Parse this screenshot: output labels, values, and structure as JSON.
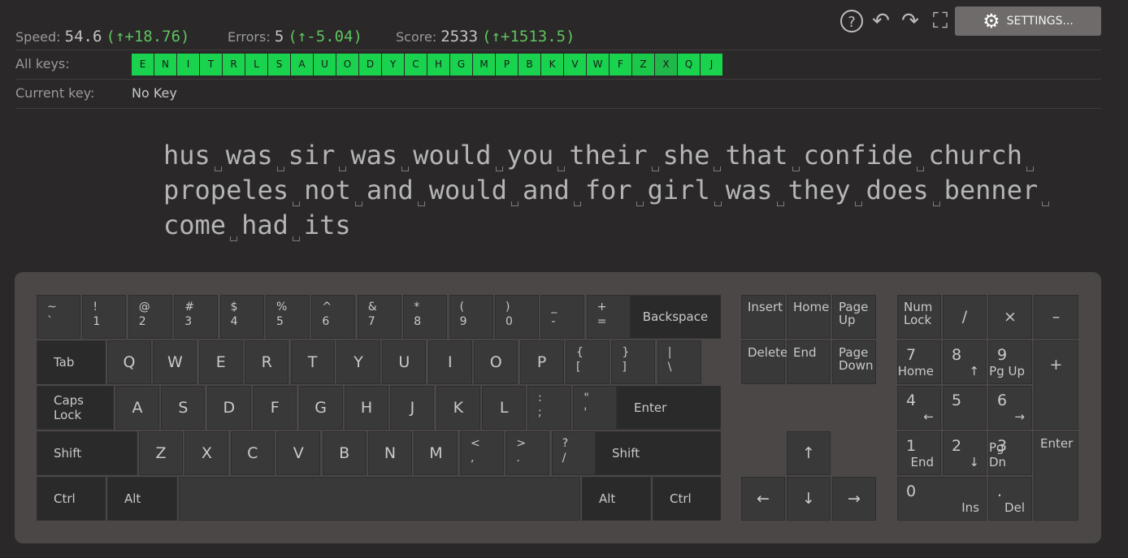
{
  "stats": {
    "speed_label": "Speed:",
    "speed_value": "54.6",
    "speed_delta": "(↑+18.76)",
    "errors_label": "Errors:",
    "errors_value": "5",
    "errors_delta": "(↑-5.04)",
    "score_label": "Score:",
    "score_value": "2533",
    "score_delta": "(↑+1513.5)"
  },
  "toolbar": {
    "help_icon": "?",
    "undo_icon": "↶",
    "redo_icon": "↷",
    "fullscreen_icon": "⛶",
    "settings_label": "SETTINGS..."
  },
  "all_keys": {
    "label": "All keys:",
    "keys": [
      "E",
      "N",
      "I",
      "T",
      "R",
      "L",
      "S",
      "A",
      "U",
      "O",
      "D",
      "Y",
      "C",
      "H",
      "G",
      "M",
      "P",
      "B",
      "K",
      "V",
      "W",
      "F",
      "Z",
      "X",
      "Q",
      "J"
    ]
  },
  "current_key": {
    "label": "Current key:",
    "value": "No Key"
  },
  "lesson": {
    "lines": [
      [
        "hus",
        "was",
        "sir",
        "was",
        "would",
        "you",
        "their",
        "she",
        "that",
        "confide",
        "church",
        ""
      ],
      [
        "propeles",
        "not",
        "and",
        "would",
        "and",
        "for",
        "girl",
        "was",
        "they",
        "does",
        "benner",
        ""
      ],
      [
        "come",
        "had",
        "its"
      ]
    ]
  },
  "keyboard": {
    "row1": [
      {
        "top": "~",
        "bot": "`"
      },
      {
        "top": "!",
        "bot": "1"
      },
      {
        "top": "@",
        "bot": "2"
      },
      {
        "top": "#",
        "bot": "3"
      },
      {
        "top": "$",
        "bot": "4"
      },
      {
        "top": "%",
        "bot": "5"
      },
      {
        "top": "^",
        "bot": "6"
      },
      {
        "top": "&",
        "bot": "7"
      },
      {
        "top": "*",
        "bot": "8"
      },
      {
        "top": "(",
        "bot": "9"
      },
      {
        "top": ")",
        "bot": "0"
      },
      {
        "top": "_",
        "bot": "-"
      },
      {
        "top": "+",
        "bot": "="
      }
    ],
    "backspace": "Backspace",
    "tab": "Tab",
    "row2": [
      "Q",
      "W",
      "E",
      "R",
      "T",
      "Y",
      "U",
      "I",
      "O",
      "P"
    ],
    "row2_sym": [
      {
        "top": "{",
        "bot": "["
      },
      {
        "top": "}",
        "bot": "]"
      },
      {
        "top": "|",
        "bot": "\\"
      }
    ],
    "caps": "Caps Lock",
    "row3": [
      "A",
      "S",
      "D",
      "F",
      "G",
      "H",
      "J",
      "K",
      "L"
    ],
    "row3_sym": [
      {
        "top": ":",
        "bot": ";"
      },
      {
        "top": "\"",
        "bot": "'"
      }
    ],
    "enter": "Enter",
    "shift_left": "Shift",
    "row4": [
      "Z",
      "X",
      "C",
      "V",
      "B",
      "N",
      "M"
    ],
    "row4_sym": [
      {
        "top": "<",
        "bot": ","
      },
      {
        "top": ">",
        "bot": "."
      },
      {
        "top": "?",
        "bot": "/"
      }
    ],
    "shift_right": "Shift",
    "ctrl_left": "Ctrl",
    "alt_left": "Alt",
    "alt_right": "Alt",
    "ctrl_right": "Ctrl",
    "nav": {
      "insert": "Insert",
      "home": "Home",
      "page_up": "Page Up",
      "delete": "Delete",
      "end": "End",
      "page_down": "Page Down",
      "up": "↑",
      "left": "←",
      "down": "↓",
      "right": "→"
    },
    "numpad": {
      "numlock": "Num Lock",
      "divide": "/",
      "multiply": "×",
      "minus": "–",
      "plus": "+",
      "enter": "Enter",
      "n7": "7",
      "n7_sub": "Home",
      "n8": "8",
      "n8_sub": "↑",
      "n9": "9",
      "n9_sub": "Pg Up",
      "n4": "4",
      "n4_sub": "←",
      "n5": "5",
      "n6": "6",
      "n6_sub": "→",
      "n1": "1",
      "n1_sub": "End",
      "n2": "2",
      "n2_sub": "↓",
      "n3": "3",
      "n3_sub": "Pg Dn",
      "n0": "0",
      "n0_sub": "Ins",
      "dot": ".",
      "dot_sub": "Del"
    }
  }
}
